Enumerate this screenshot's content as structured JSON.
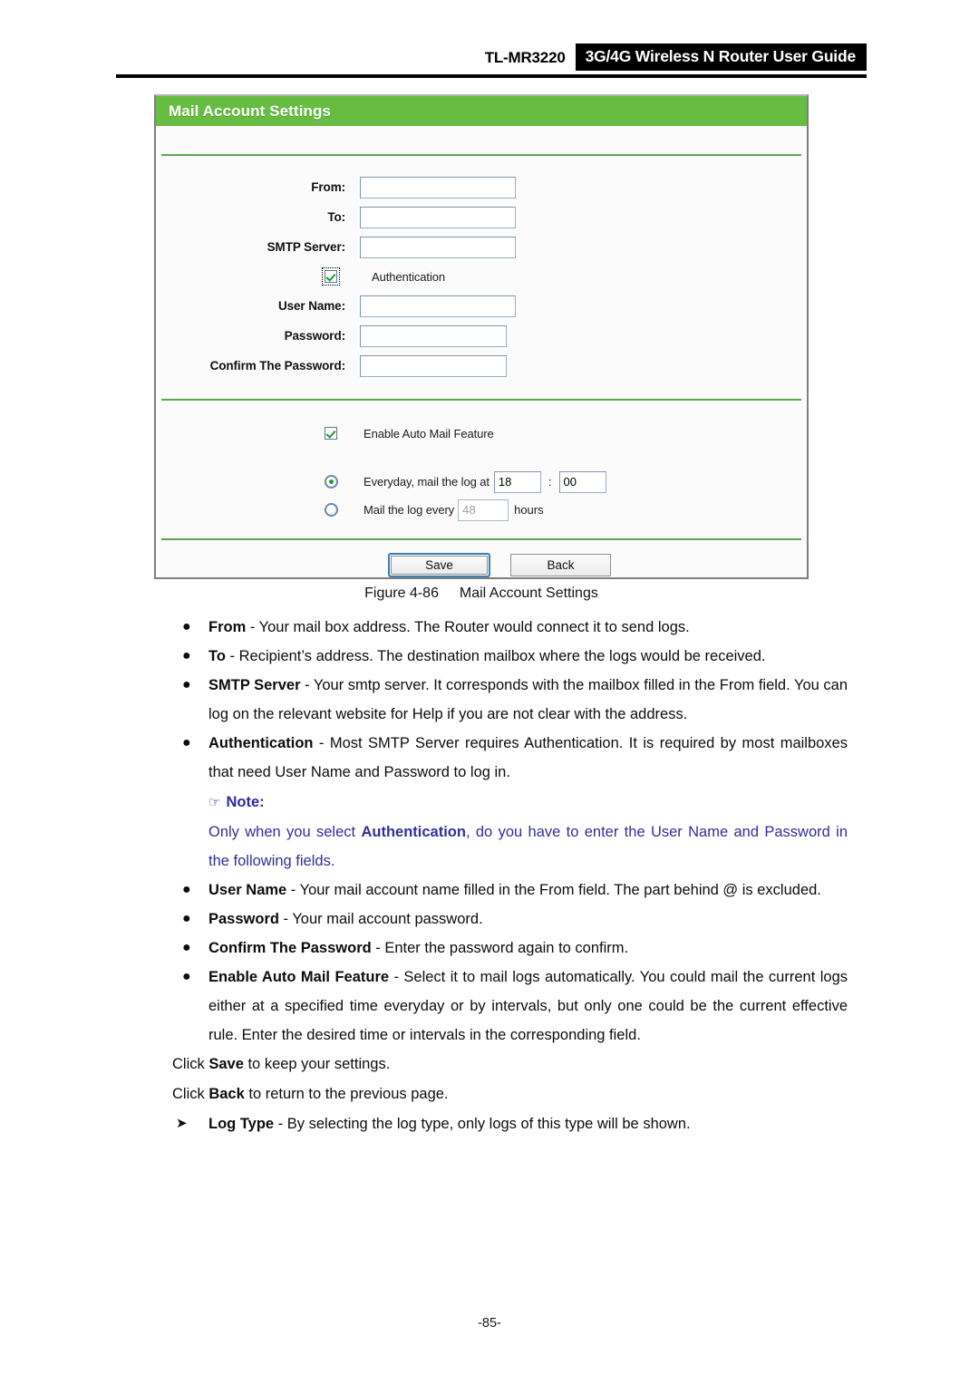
{
  "header": {
    "model": "TL-MR3220",
    "guide_title": "3G/4G Wireless N Router User Guide"
  },
  "panel": {
    "title": "Mail Account Settings",
    "fields": [
      {
        "label": "From:",
        "value": "",
        "width": "wide"
      },
      {
        "label": "To:",
        "value": "",
        "width": "wide"
      },
      {
        "label": "SMTP Server:",
        "value": "",
        "width": "wide"
      }
    ],
    "authentication_checkbox": {
      "label": "Authentication",
      "checked": true,
      "focused": true
    },
    "auth_fields": [
      {
        "label": "User Name:",
        "value": "",
        "width": "wide"
      },
      {
        "label": "Password:",
        "value": "",
        "width": "mid"
      },
      {
        "label": "Confirm The Password:",
        "value": "",
        "width": "mid"
      }
    ],
    "auto_mail_checkbox": {
      "label": "Enable Auto Mail Feature",
      "checked": true
    },
    "schedule": {
      "everyday": {
        "selected": true,
        "label": "Everyday, mail the log at",
        "hour": "18",
        "separator": ":",
        "minute": "00"
      },
      "interval": {
        "selected": false,
        "label_before": "Mail the log every",
        "hours": "48",
        "label_after": "hours"
      }
    },
    "buttons": {
      "save": "Save",
      "back": "Back"
    }
  },
  "figure": {
    "number": "Figure 4-86",
    "caption": "Mail Account Settings"
  },
  "body": {
    "bullets": [
      {
        "term": "From",
        "text": " - Your mail box address. The Router would connect it to send logs."
      },
      {
        "term": "To",
        "text": " - Recipient’s address. The destination mailbox where the logs would be received."
      },
      {
        "term": "SMTP Server",
        "text": " - Your smtp server. It corresponds with the mailbox filled in the From field. You can log on the relevant website for Help if you are not clear with the address."
      },
      {
        "term": "Authentication",
        "text": " - Most SMTP Server requires Authentication. It is required by most mailboxes that need User Name and Password to log in."
      }
    ],
    "note": {
      "icon": "pointing-hand",
      "heading": "Note:",
      "text_before": "Only when you select ",
      "emphasis": "Authentication",
      "text_after": ", do you have to enter the User Name and Password in the following fields."
    },
    "bullets2": [
      {
        "term": "User Name",
        "text": " - Your mail account name filled in the From field. The part behind @ is excluded."
      },
      {
        "term": "Password",
        "text": " - Your mail account password."
      },
      {
        "term": "Confirm The Password",
        "text": " - Enter the password again to confirm."
      },
      {
        "term": "Enable Auto Mail Feature",
        "text": " - Select it to mail logs automatically. You could mail the current logs either at a specified time everyday or by intervals, but only one could be the current effective rule. Enter the desired time or intervals in the corresponding field."
      }
    ],
    "click_lines": [
      {
        "before": "Click ",
        "term": "Save",
        "after": " to keep your settings."
      },
      {
        "before": "Click ",
        "term": "Back",
        "after": " to return to the previous page."
      }
    ],
    "arrow_item": {
      "term": "Log Type",
      "text": " - By selecting the log type, only logs of this type will be shown."
    }
  },
  "footer": {
    "page_number": "-85-"
  }
}
